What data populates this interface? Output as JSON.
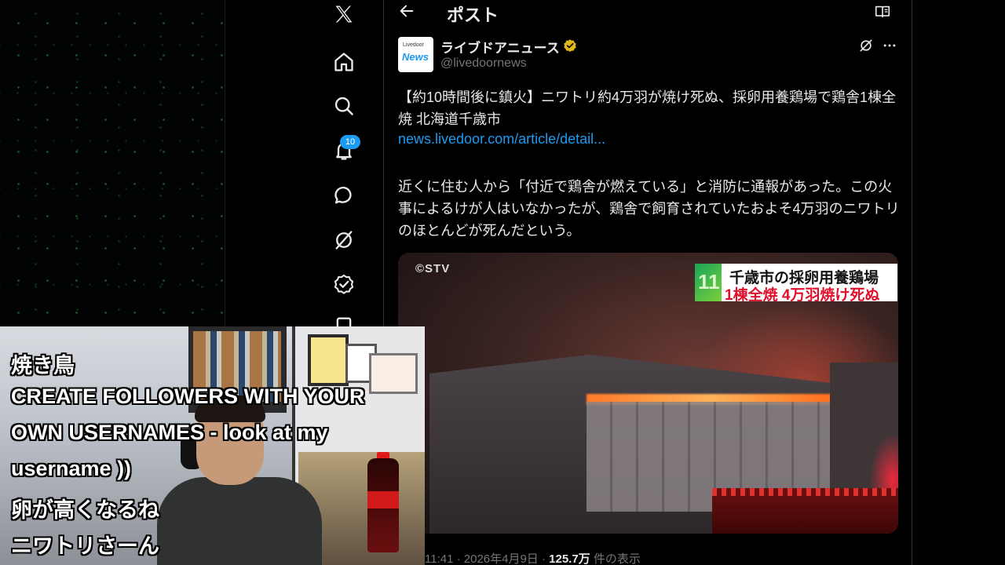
{
  "colors": {
    "background": "#000000",
    "text_primary": "#e7e9ea",
    "text_secondary": "#71767b",
    "accent_blue": "#1d9bf0",
    "verified_gold": "#e2b719"
  },
  "nav": {
    "icons": [
      "x-logo-icon",
      "home-icon",
      "search-icon",
      "bell-icon",
      "chat-icon",
      "grok-icon",
      "verified-check-icon",
      "more-icon"
    ],
    "notification_count": "10"
  },
  "header": {
    "title": "ポスト"
  },
  "post": {
    "avatar_text_top": "Livedoor",
    "avatar_text_logo": "News",
    "display_name": "ライブドアニュース",
    "handle": "@livedoornews",
    "text": "【約10時間後に鎮火】ニワトリ約4万羽が焼け死ぬ、採卵用養鶏場で鶏舎1棟全焼 北海道千歳市",
    "link": "news.livedoor.com/article/detail...",
    "body": "近くに住む人から「付近で鶏舎が燃えている」と消防に通報があった。この火事によるけが人はいなかったが、鶏舎で飼育されていたおよそ4万羽のニワトリのほとんどが死んだという。",
    "media": {
      "watermark": "©STV",
      "caption_mark": "11",
      "caption_line1": "千歳市の採卵用養鶏場",
      "caption_line2": "1棟全焼 4万羽焼け死ぬ"
    },
    "meta_time": "11:41 · 2026年4月9日 · ",
    "meta_views": "125.7万",
    "meta_suffix": " 件の表示"
  },
  "overlay": {
    "chat_lines": [
      "焼き鳥",
      "CREATE FOLLOWERS WITH YOUR",
      "OWN USERNAMES - look at my",
      "username ))",
      "卵が高くなるね",
      "ニワトリさーん"
    ]
  }
}
